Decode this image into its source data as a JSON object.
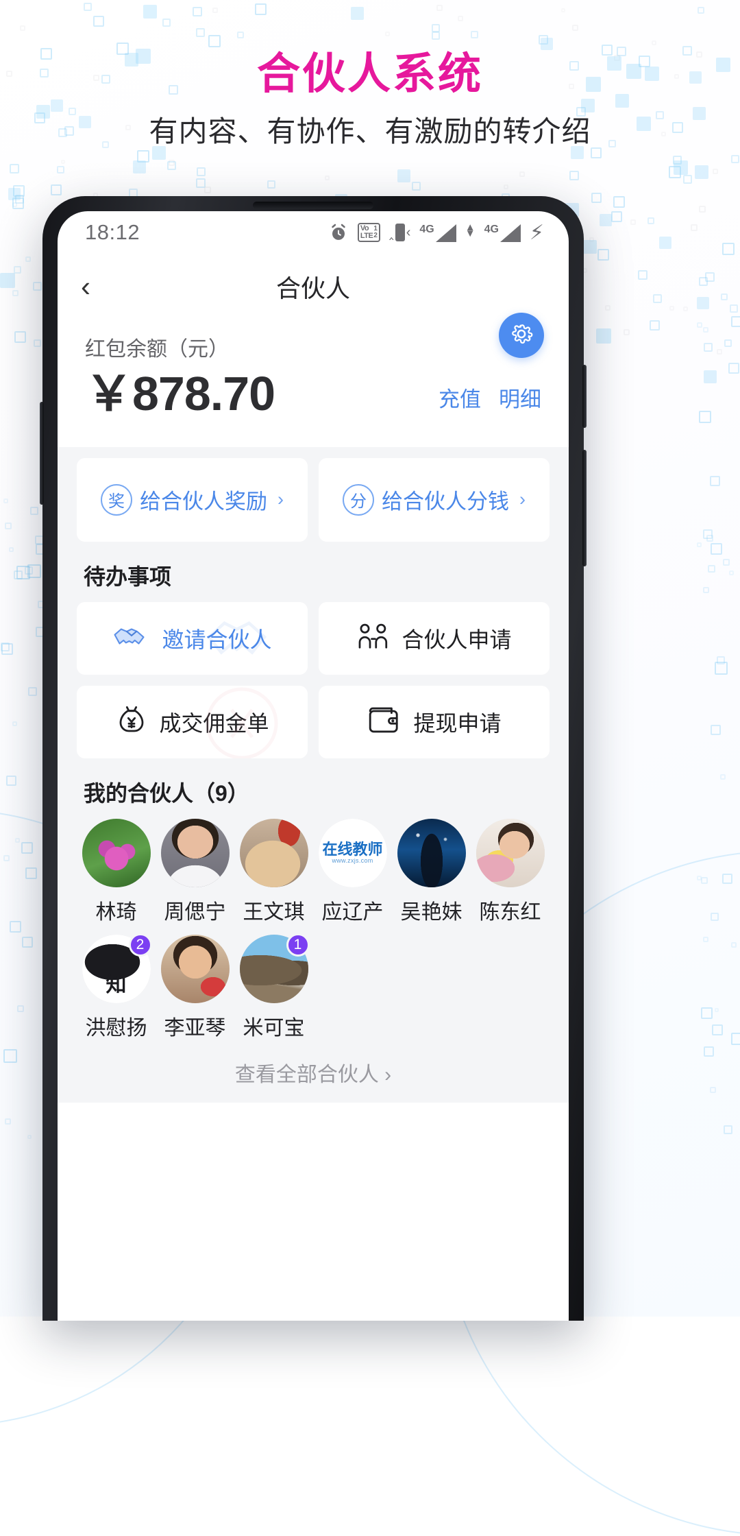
{
  "promo": {
    "title": "合伙人系统",
    "subtitle": "有内容、有协作、有激励的转介绍",
    "title_color": "#e6189c"
  },
  "status_bar": {
    "time": "18:12",
    "icons": [
      "alarm-icon",
      "volte-icon",
      "vibrate-icon",
      "signal-4g-1-icon",
      "signal-4g-2-icon",
      "charging-bolt-icon"
    ],
    "volte_label": "Vo LTE",
    "volte_sim1": "1",
    "volte_sim2": "2",
    "network_label_1": "4G",
    "network_label_2": "4G"
  },
  "appbar": {
    "back": "‹",
    "title": "合伙人"
  },
  "balance": {
    "label": "红包余额（元）",
    "currency": "￥",
    "amount": "878.70",
    "recharge_label": "充值",
    "detail_label": "明细",
    "settings_icon": "gear-icon",
    "accent_color": "#4d8cf0"
  },
  "action_cards": [
    {
      "badge": "奖",
      "label": "给合伙人奖励",
      "chevron": "›"
    },
    {
      "badge": "分",
      "label": "给合伙人分钱",
      "chevron": "›"
    }
  ],
  "todo": {
    "section_title": "待办事项",
    "items": [
      {
        "icon": "handshake-icon",
        "label": "邀请合伙人",
        "style": "blue"
      },
      {
        "icon": "people-application-icon",
        "label": "合伙人申请",
        "style": "dark"
      },
      {
        "icon": "money-bag-icon",
        "label": "成交佣金单",
        "style": "dark"
      },
      {
        "icon": "wallet-icon",
        "label": "提现申请",
        "style": "dark"
      }
    ]
  },
  "partners": {
    "section_title": "我的合伙人（9）",
    "list": [
      {
        "name": "林琦",
        "avatar": "flower-photo",
        "badge": ""
      },
      {
        "name": "周偲宁",
        "avatar": "woman-white-suit-photo",
        "badge": ""
      },
      {
        "name": "王文琪",
        "avatar": "cat-photo",
        "badge": ""
      },
      {
        "name": "应辽产",
        "avatar": "zaixian-jiaoshi-logo",
        "badge": ""
      },
      {
        "name": "吴艳妹",
        "avatar": "night-sky-photo",
        "badge": ""
      },
      {
        "name": "陈东红",
        "avatar": "woman-flowers-photo",
        "badge": ""
      },
      {
        "name": "洪慰扬",
        "avatar": "zhihu-logo",
        "badge": "2"
      },
      {
        "name": "李亚琴",
        "avatar": "woman-sunglasses-photo",
        "badge": ""
      },
      {
        "name": "米可宝",
        "avatar": "mountain-road-photo",
        "badge": "1"
      }
    ],
    "see_all_label": "查看全部合伙人",
    "see_all_chevron": "›",
    "badge_color": "#7b3ff2"
  }
}
